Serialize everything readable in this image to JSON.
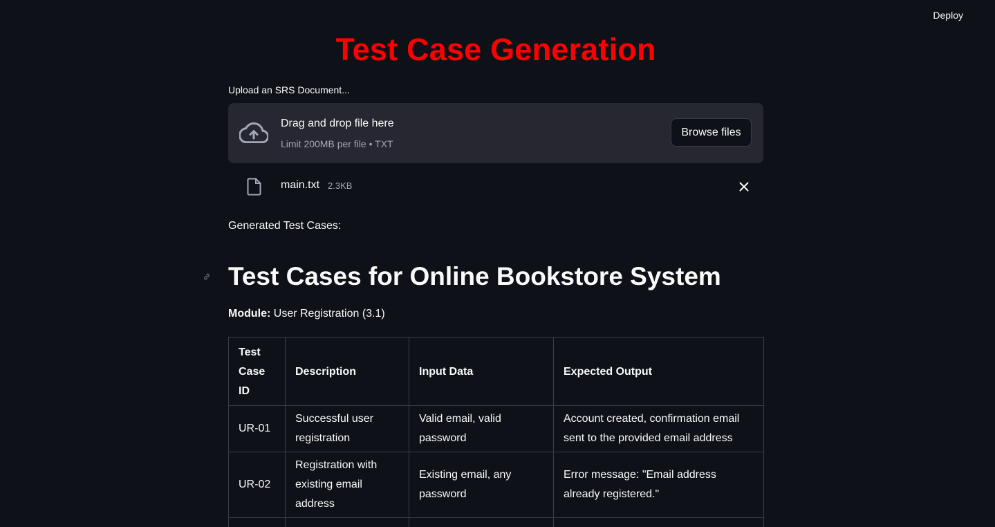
{
  "header": {
    "deploy_label": "Deploy"
  },
  "app": {
    "title": "Test Case Generation",
    "title_color": "#ff0000"
  },
  "uploader": {
    "label": "Upload an SRS Document...",
    "drop_text": "Drag and drop file here",
    "limit_text": "Limit 200MB per file • TXT",
    "browse_label": "Browse files",
    "icon": "cloud-upload-icon"
  },
  "uploaded_file": {
    "name": "main.txt",
    "size": "2.3KB",
    "icon": "file-icon",
    "remove_icon": "close-icon"
  },
  "output": {
    "label": "Generated Test Cases:",
    "heading": "Test Cases for Online Bookstore System",
    "module_label": "Module:",
    "module_value": " User Registration (3.1)"
  },
  "table": {
    "headers": [
      "Test Case ID",
      "Description",
      "Input Data",
      "Expected Output"
    ],
    "rows": [
      [
        "UR-01",
        "Successful user registration",
        "Valid email, valid password",
        "Account created, confirmation email sent to the provided email address"
      ],
      [
        "UR-02",
        "Registration with existing email address",
        "Existing email, any password",
        "Error message: \"Email address already registered.\""
      ],
      [
        "",
        "",
        "",
        ""
      ]
    ]
  }
}
